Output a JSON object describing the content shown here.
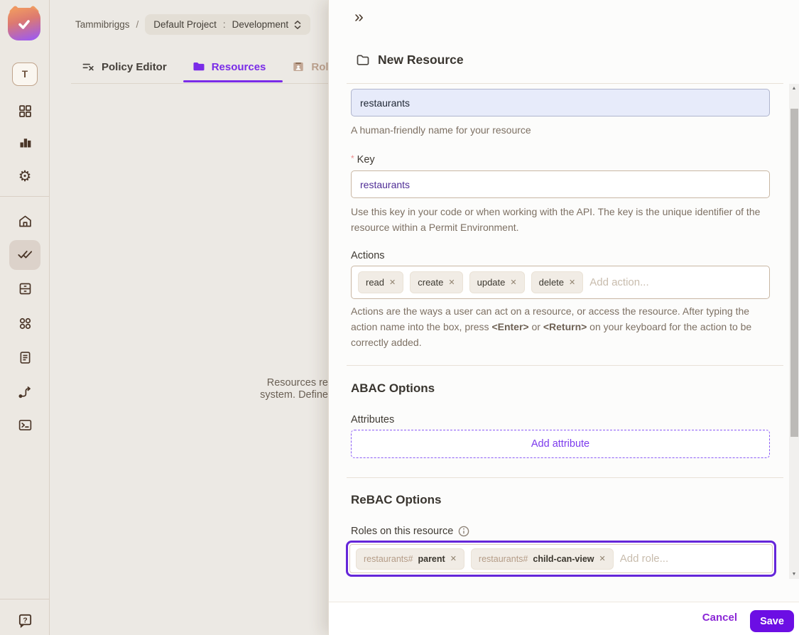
{
  "icons": {
    "remove_tag": "✕",
    "collapse_drawer": "»",
    "scroll_up": "▲",
    "scroll_down": "▼"
  },
  "colors": {
    "accent_purple": "#7A2CE8",
    "save_button": "#6C0EE4",
    "focus_border": "#6526D9"
  },
  "sidebar": {
    "avatar_letter": "T"
  },
  "breadcrumb": {
    "workspace": "Tammibriggs",
    "separator": "/",
    "project": "Default Project",
    "colon": ":",
    "environment": "Development"
  },
  "tabs": [
    {
      "label": "Policy Editor"
    },
    {
      "label": "Resources"
    },
    {
      "label": "Rol"
    }
  ],
  "background_text": {
    "line1": "Resources re",
    "line2": "system. Define"
  },
  "drawer": {
    "title": "New Resource",
    "name_field": {
      "value": "restaurants",
      "helper": "A human-friendly name for your resource"
    },
    "key_field": {
      "required_mark": "*",
      "label": "Key",
      "value": "restaurants",
      "helper": "Use this key in your code or when working with the API. The key is the unique identifier of the resource within a Permit Environment."
    },
    "actions_field": {
      "label": "Actions",
      "tags": [
        "read",
        "create",
        "update",
        "delete"
      ],
      "placeholder": "Add action...",
      "helper_pre": "Actions are the ways a user can act on a resource, or access the resource. After typing the action name into the box, press ",
      "helper_enter": "<Enter>",
      "helper_or": " or ",
      "helper_return": "<Return>",
      "helper_post": " on your keyboard for the action to be correctly added."
    },
    "abac": {
      "heading": "ABAC Options",
      "attributes_label": "Attributes",
      "add_attribute_label": "Add attribute"
    },
    "rebac": {
      "heading": "ReBAC Options",
      "roles_label": "Roles on this resource",
      "role_tags": [
        {
          "prefix": "restaurants#",
          "name": "parent"
        },
        {
          "prefix": "restaurants#",
          "name": "child-can-view"
        }
      ],
      "placeholder": "Add role..."
    },
    "footer": {
      "cancel": "Cancel",
      "save": "Save"
    }
  }
}
